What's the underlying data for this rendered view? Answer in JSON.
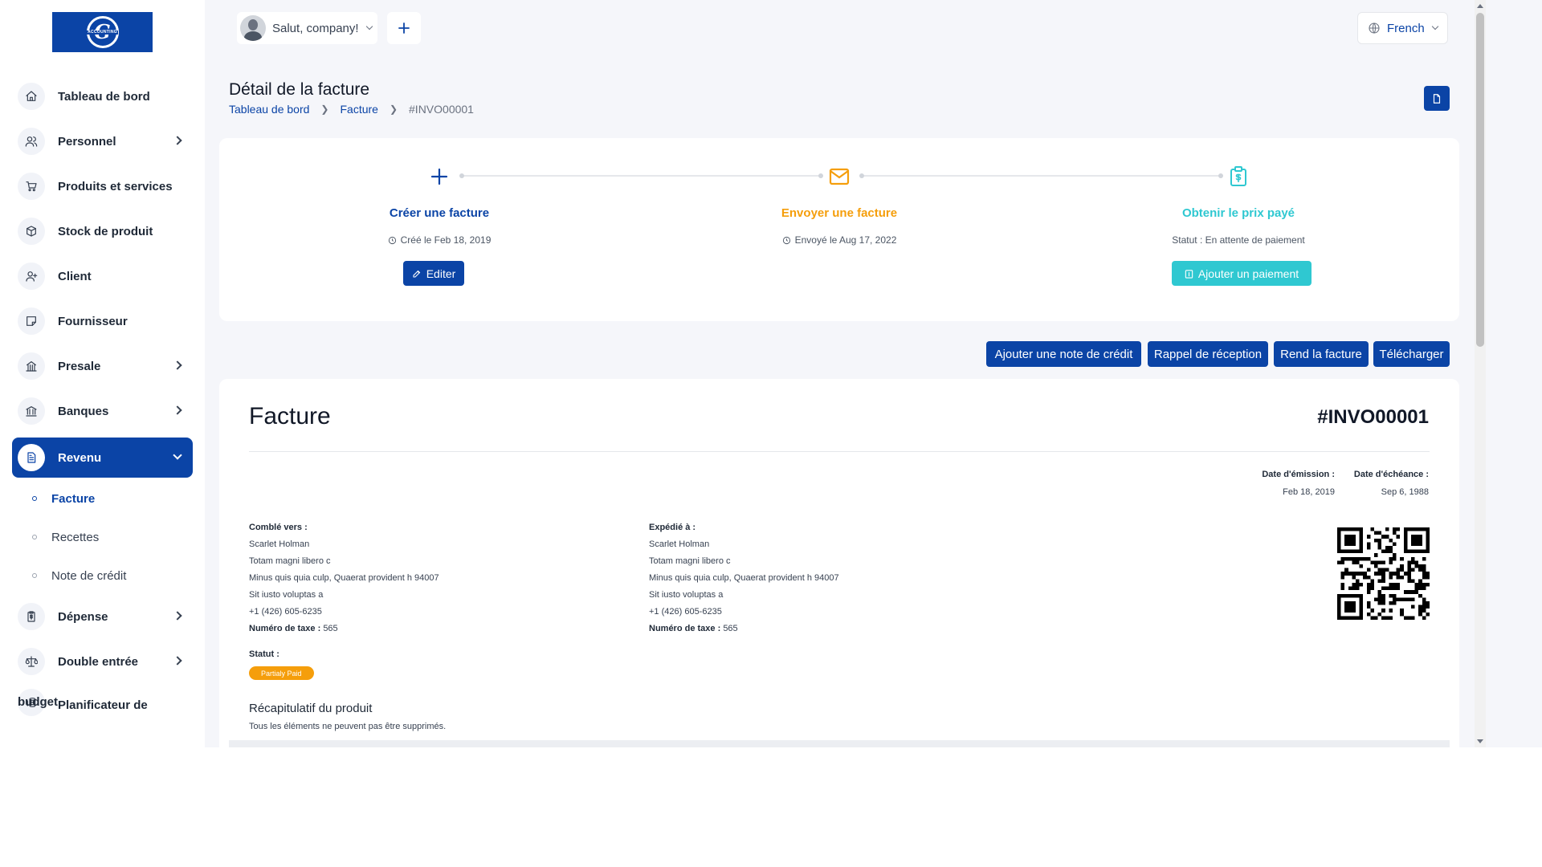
{
  "logo": {
    "monogram": "G",
    "text": "ACCOUNTING"
  },
  "header": {
    "greeting": "Salut, company!",
    "language": "French"
  },
  "sidebar": {
    "items": [
      {
        "label": "Tableau de bord",
        "icon": "home-icon"
      },
      {
        "label": "Personnel",
        "icon": "users-icon"
      },
      {
        "label": "Produits et services",
        "icon": "cart-icon"
      },
      {
        "label": "Stock de produit",
        "icon": "box-icon"
      },
      {
        "label": "Client",
        "icon": "user-plus-icon"
      },
      {
        "label": "Fournisseur",
        "icon": "sticky-note-icon"
      },
      {
        "label": "Presale",
        "icon": "building-icon"
      },
      {
        "label": "Banques",
        "icon": "bank-icon"
      },
      {
        "label": "Revenu",
        "icon": "file-invoice-icon"
      },
      {
        "label": "Dépense",
        "icon": "clipboard-dollar-icon"
      },
      {
        "label": "Double entrée",
        "icon": "scale-icon"
      },
      {
        "label": "Planificateur de",
        "label2": "budget",
        "icon": "coins-icon"
      }
    ],
    "revenu_sub": [
      {
        "label": "Facture"
      },
      {
        "label": "Recettes"
      },
      {
        "label": "Note de crédit"
      }
    ]
  },
  "page": {
    "title": "Détail de la facture",
    "breadcrumb": [
      "Tableau de bord",
      "Facture",
      "#INVO00001"
    ]
  },
  "steps": [
    {
      "title": "Créer une facture",
      "meta": "Créé le Feb 18, 2019",
      "button": "Editer",
      "color": "#0b44a6"
    },
    {
      "title": "Envoyer une facture",
      "meta": "Envoyé le Aug 17, 2022",
      "color": "#f59e0b"
    },
    {
      "title": "Obtenir le prix payé",
      "meta": "Statut : En attente de paiement",
      "button": "Ajouter un paiement",
      "color": "#2fc8d1"
    }
  ],
  "actions": [
    "Ajouter une note de crédit",
    "Rappel de réception",
    "Rend la facture",
    "Télécharger"
  ],
  "invoice": {
    "title": "Facture",
    "number": "#INVO00001",
    "issue_label": "Date d'émission :",
    "issue_date": "Feb 18, 2019",
    "due_label": "Date d'échéance :",
    "due_date": "Sep 6, 1988",
    "billed": {
      "label": "Comblé vers :",
      "name": "Scarlet Holman",
      "line1": "Totam magni libero c",
      "line2": "Minus quis quia culp, Quaerat provident h 94007",
      "line3": "Sit iusto voluptas a",
      "phone": "+1 (426) 605-6235",
      "tax_label": "Numéro de taxe :",
      "tax": "565"
    },
    "shipped": {
      "label": "Expédié à :",
      "name": "Scarlet Holman",
      "line1": "Totam magni libero c",
      "line2": "Minus quis quia culp, Quaerat provident h 94007",
      "line3": "Sit iusto voluptas a",
      "phone": "+1 (426) 605-6235",
      "tax_label": "Numéro de taxe :",
      "tax": "565"
    },
    "status_label": "Statut :",
    "status": "Partialy Paid",
    "summary_title": "Récapitulatif du produit",
    "summary_sub": "Tous les éléments ne peuvent pas être supprimés."
  },
  "colors": {
    "primary": "#0b44a6",
    "warning": "#f59e0b",
    "info": "#2fc8d1"
  }
}
